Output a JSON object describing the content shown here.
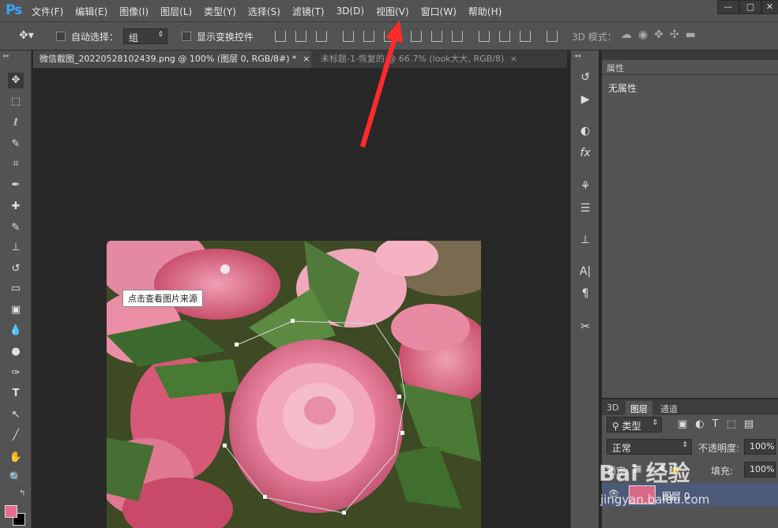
{
  "app": {
    "logo": "Ps"
  },
  "menu": [
    "文件(F)",
    "编辑(E)",
    "图像(I)",
    "图层(L)",
    "类型(Y)",
    "选择(S)",
    "滤镜(T)",
    "3D(D)",
    "视图(V)",
    "窗口(W)",
    "帮助(H)"
  ],
  "window_controls": {
    "minimize": "—",
    "restore": "▢",
    "close": "✕"
  },
  "options": {
    "auto_select_label": "自动选择：",
    "auto_select_value": "组",
    "transform_label": "显示变换控件",
    "mode3d_label": "3D 模式："
  },
  "tabs": [
    {
      "label": "微信截图_20220528102439.png @ 100% (图层 0, RGB/8#) *",
      "close": "×"
    },
    {
      "label": "未标题-1-恢复的 @ 66.7% (look大大, RGB/8)",
      "close": "×"
    }
  ],
  "tooltip": "点击查看图片来源",
  "properties": {
    "title": "属性",
    "text": "无属性"
  },
  "layers_panel": {
    "tabs": [
      "3D",
      "图层",
      "通道"
    ],
    "filter_label": "类型",
    "blend_mode": "正常",
    "opacity_label": "不透明度:",
    "opacity_value": "100%",
    "lock_label": "锁定:",
    "fill_label": "填充:",
    "fill_value": "100%",
    "layer_name": "图层 0"
  },
  "watermark": {
    "brand": "Bai 经验",
    "url": "jingyan.baidu.com"
  },
  "colors": {
    "accent": "#31a8ff",
    "arrow": "#ff2a2a",
    "foreground": "#e86b8f",
    "background": "#000000"
  }
}
